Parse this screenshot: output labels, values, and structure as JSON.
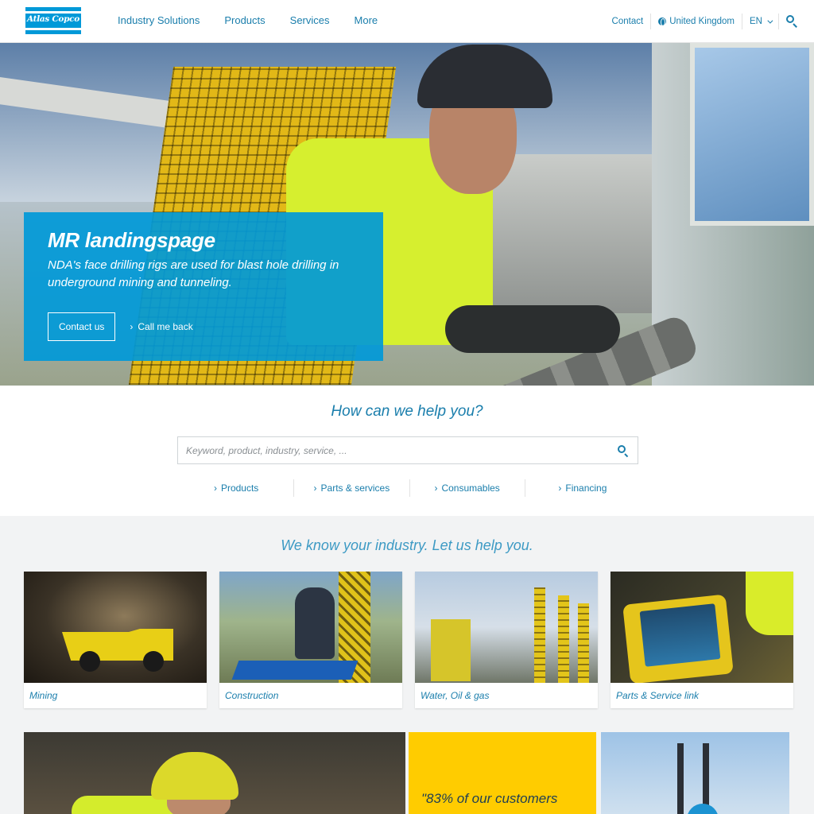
{
  "header": {
    "logo_text": "Atlas Copco",
    "nav": [
      "Industry Solutions",
      "Products",
      "Services",
      "More"
    ],
    "contact": "Contact",
    "region": "United Kingdom",
    "language": "EN"
  },
  "hero": {
    "title": "MR landingspage",
    "subtitle": "NDA's face drilling rigs are used for blast hole drilling in underground mining and tunneling.",
    "primary_button": "Contact us",
    "secondary_link": "Call me back"
  },
  "help": {
    "heading": "How can we help you?",
    "search_placeholder": "Keyword, product, industry, service, ...",
    "links": [
      "Products",
      "Parts & services",
      "Consumables",
      "Financing"
    ]
  },
  "industries": {
    "heading": "We know your industry. Let us help you.",
    "cards": [
      {
        "label": "Mining"
      },
      {
        "label": "Construction"
      },
      {
        "label": "Water, Oil & gas"
      },
      {
        "label": "Parts & Service link"
      }
    ]
  },
  "promo": {
    "quote": "\"83% of our customers"
  },
  "colors": {
    "brand_blue": "#0099d8",
    "link_blue": "#1a7eac",
    "promo_yellow": "#ffcc00",
    "section_grey": "#f2f3f4"
  },
  "icons": {
    "search": "search-icon",
    "globe": "globe-icon",
    "chevron": "chevron-down-icon",
    "arrow": "chevron-right-icon"
  }
}
